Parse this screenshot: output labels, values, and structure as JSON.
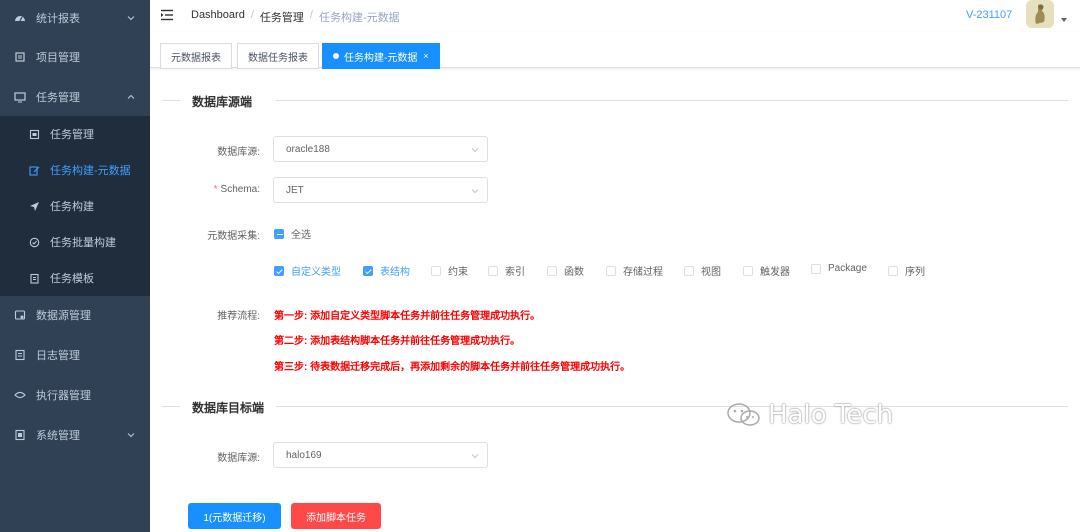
{
  "sidebar": {
    "items": [
      {
        "label": "统计报表",
        "icon": "dashboard-icon"
      },
      {
        "label": "项目管理",
        "icon": "list-icon"
      },
      {
        "label": "任务管理",
        "icon": "monitor-icon"
      },
      {
        "label": "数据源管理",
        "icon": "database-icon"
      },
      {
        "label": "日志管理",
        "icon": "log-icon"
      },
      {
        "label": "执行器管理",
        "icon": "executor-icon"
      },
      {
        "label": "系统管理",
        "icon": "system-icon"
      }
    ],
    "subitems": [
      {
        "label": "任务管理",
        "icon": "task-icon"
      },
      {
        "label": "任务构建-元数据",
        "icon": "edit-icon"
      },
      {
        "label": "任务构建",
        "icon": "send-icon"
      },
      {
        "label": "任务批量构建",
        "icon": "batch-icon"
      },
      {
        "label": "任务模板",
        "icon": "template-icon"
      }
    ]
  },
  "navbar": {
    "breadcrumb": [
      "Dashboard",
      "任务管理",
      "任务构建-元数据"
    ],
    "version": "V-231107"
  },
  "tags": [
    {
      "label": "元数据报表"
    },
    {
      "label": "数据任务报表"
    },
    {
      "label": "任务构建-元数据",
      "close": "×"
    }
  ],
  "form": {
    "source_section": "数据库源端",
    "source_label": "数据库源:",
    "source_value": "oracle188",
    "schema_required": "*",
    "schema_label": "Schema:",
    "schema_value": "JET",
    "collect_label": "元数据采集:",
    "select_all": "全选",
    "checkboxes": [
      {
        "label": "自定义类型",
        "checked": true
      },
      {
        "label": "表结构",
        "checked": true
      },
      {
        "label": "约束",
        "checked": false
      },
      {
        "label": "索引",
        "checked": false
      },
      {
        "label": "函数",
        "checked": false
      },
      {
        "label": "存储过程",
        "checked": false
      },
      {
        "label": "视图",
        "checked": false
      },
      {
        "label": "触发器",
        "checked": false
      },
      {
        "label": "Package",
        "checked": false
      },
      {
        "label": "序列",
        "checked": false
      }
    ],
    "flow_label": "推荐流程:",
    "steps": [
      "第一步: 添加自定义类型脚本任务并前往任务管理成功执行。",
      "第二步: 添加表结构脚本任务并前往任务管理成功执行。",
      "第三步: 待表数据迁移完成后，再添加剩余的脚本任务并前往任务管理成功执行。"
    ],
    "target_section": "数据库目标端",
    "target_label": "数据库源:",
    "target_value": "halo169",
    "btn_migrate": "1(元数据迁移)",
    "btn_add": "添加脚本任务"
  },
  "watermark": "Halo Tech",
  "colors": {
    "sidebar_bg": "#304156",
    "submenu_bg": "#1f2d3d",
    "primary": "#1890ff",
    "danger": "#ff4949",
    "step_red": "#ff0000"
  }
}
